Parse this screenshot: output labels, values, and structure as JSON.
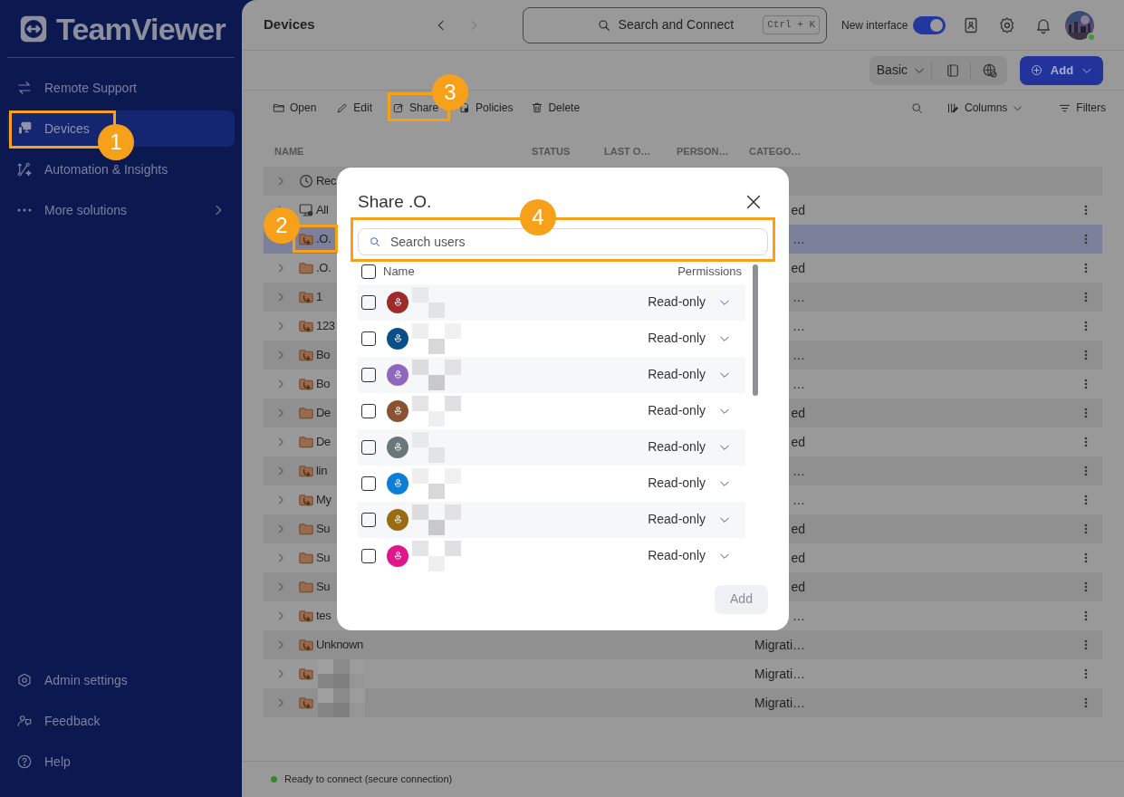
{
  "sidebar": {
    "logo": "TeamViewer",
    "items": [
      {
        "label": "Remote Support",
        "selected": false
      },
      {
        "label": "Devices",
        "selected": true
      },
      {
        "label": "Automation & Insights",
        "selected": false
      },
      {
        "label": "More solutions",
        "selected": false,
        "submenu": true
      }
    ],
    "footer_items": [
      {
        "label": "Admin settings"
      },
      {
        "label": "Feedback"
      },
      {
        "label": "Help"
      }
    ]
  },
  "header": {
    "title": "Devices",
    "back_disabled": false,
    "forward_disabled": true,
    "search": {
      "label": "Search and Connect",
      "shortcut": "Ctrl + K"
    },
    "toggle": {
      "label": "New interface",
      "on": true
    },
    "online": true
  },
  "view_bar": {
    "view": "Basic",
    "add_button": "Add"
  },
  "toolbar": {
    "actions": [
      "Open",
      "Edit",
      "Share",
      "Policies",
      "Delete"
    ],
    "columns_button": "Columns",
    "filters_button": "Filters"
  },
  "table": {
    "columns": [
      "NAME",
      "STATUS",
      "LAST O…",
      "PERSON…",
      "CATEGO…"
    ],
    "rows": [
      {
        "kind": "recent",
        "name": "Rec",
        "selected": false
      },
      {
        "kind": "all",
        "name": "All",
        "category": "ed",
        "selected": false
      },
      {
        "kind": "shared-folder",
        "name": ".O.",
        "category": "…",
        "selected": true
      },
      {
        "kind": "folder",
        "name": ".O.",
        "category": "ed",
        "selected": false
      },
      {
        "kind": "shared-folder",
        "name": "1",
        "category": "…",
        "selected": false
      },
      {
        "kind": "shared-folder",
        "name": "123",
        "category": "…",
        "selected": false
      },
      {
        "kind": "shared-folder",
        "name": "Bo",
        "category": "…",
        "selected": false
      },
      {
        "kind": "shared-folder",
        "name": "Bo",
        "category": "…",
        "selected": false
      },
      {
        "kind": "folder",
        "name": "De",
        "category": "ed",
        "selected": false
      },
      {
        "kind": "folder",
        "name": "De",
        "category": "ed",
        "selected": false
      },
      {
        "kind": "shared-folder",
        "name": "lin",
        "category": "…",
        "selected": false
      },
      {
        "kind": "shared-folder",
        "name": "My",
        "category": "…",
        "selected": false
      },
      {
        "kind": "folder",
        "name": "Su",
        "category": "ed",
        "selected": false
      },
      {
        "kind": "folder",
        "name": "Su",
        "category": "ed",
        "selected": false
      },
      {
        "kind": "folder",
        "name": "Su",
        "category": "ed",
        "selected": false
      },
      {
        "kind": "shared-folder",
        "name": "tes",
        "category": "…",
        "selected": false
      },
      {
        "kind": "shared-folder",
        "name": "Unknown",
        "category": "Migrati…",
        "selected": false
      },
      {
        "kind": "shared-folder",
        "redacted": true,
        "category": "Migrati…",
        "selected": false
      },
      {
        "kind": "shared-folder",
        "redacted": true,
        "category": "Migrati…",
        "selected": false
      }
    ]
  },
  "dialog": {
    "title": "Share .O.",
    "search_placeholder": "Search users",
    "name_column": "Name",
    "permissions_column": "Permissions",
    "select_all_checked": false,
    "users": [
      {
        "color": "#9e2a2b",
        "checked": false,
        "permission": "Read-only",
        "focused": true
      },
      {
        "color": "#0b4f8a",
        "checked": false,
        "permission": "Read-only",
        "focused": false
      },
      {
        "color": "#8d68bd",
        "checked": false,
        "permission": "Read-only",
        "focused": false
      },
      {
        "color": "#8a5230",
        "checked": false,
        "permission": "Read-only",
        "focused": false
      },
      {
        "color": "#6a7678",
        "checked": false,
        "permission": "Read-only",
        "focused": false
      },
      {
        "color": "#0c7ed8",
        "checked": false,
        "permission": "Read-only",
        "focused": false
      },
      {
        "color": "#9a6b10",
        "checked": false,
        "permission": "Read-only",
        "focused": false
      },
      {
        "color": "#e0168b",
        "checked": false,
        "permission": "Read-only",
        "focused": false
      }
    ],
    "add_button": {
      "label": "Add",
      "disabled": true
    }
  },
  "status_bar": {
    "text": "Ready to connect (secure connection)",
    "connected": true
  },
  "callouts": [
    {
      "number": "1"
    },
    {
      "number": "2"
    },
    {
      "number": "3"
    },
    {
      "number": "4"
    }
  ]
}
